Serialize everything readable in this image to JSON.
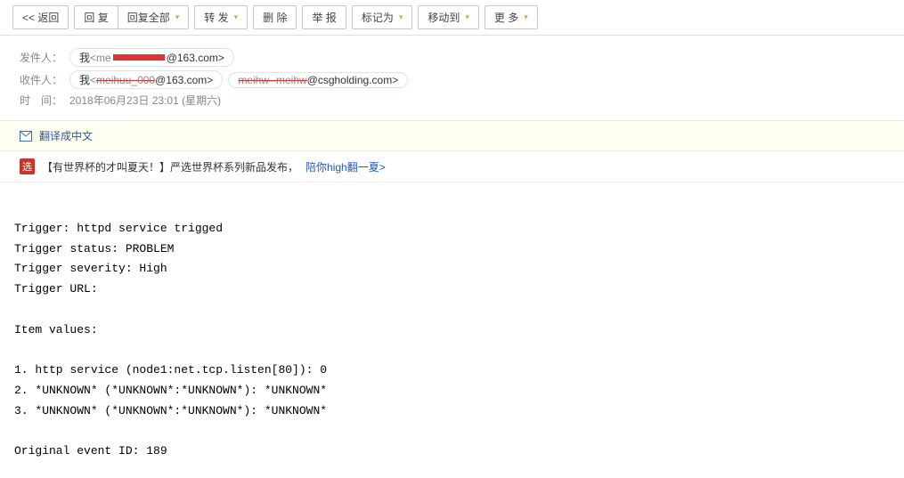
{
  "toolbar": {
    "back": "<< 返回",
    "reply": "回 复",
    "reply_all": "回复全部",
    "forward": "转 发",
    "delete": "删 除",
    "spam": "举 报",
    "mark_as": "标记为",
    "move_to": "移动到",
    "more": "更 多"
  },
  "header": {
    "from_label": "发件人：",
    "to_label": "收件人：",
    "time_label": "时　间：",
    "from_me": "我",
    "from_domain": "@163.com>",
    "to1_me": "我",
    "to1_domain": "@163.com>",
    "to2_domain": "@csgholding.com>",
    "time_value": "2018年06月23日 23:01 (星期六)"
  },
  "banner1": {
    "text": "翻译成中文"
  },
  "banner2": {
    "badge": "选",
    "text": "【有世界杯的才叫夏天！】严选世界杯系列新品发布，",
    "link": "陪你high翻一夏>"
  },
  "body": {
    "l1": "Trigger: httpd service trigged",
    "l2": "Trigger status: PROBLEM",
    "l3": "Trigger severity: High",
    "l4": "Trigger URL:",
    "l5": "Item values:",
    "l6": "1. http service (node1:net.tcp.listen[80]): 0",
    "l7": "2. *UNKNOWN* (*UNKNOWN*:*UNKNOWN*): *UNKNOWN*",
    "l8": "3. *UNKNOWN* (*UNKNOWN*:*UNKNOWN*): *UNKNOWN*",
    "l9": "Original event ID: 189"
  }
}
